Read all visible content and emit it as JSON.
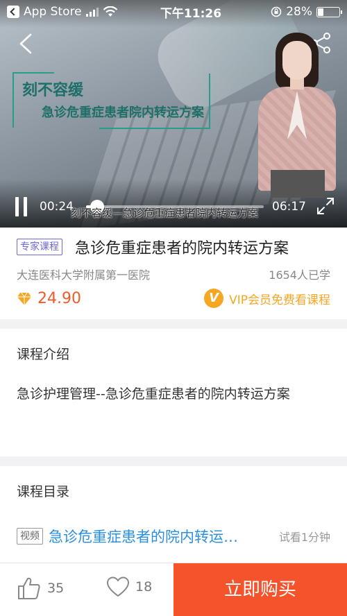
{
  "status_bar": {
    "back_app": "App Store",
    "time": "下午11:26",
    "battery_percent": "28%",
    "battery_level": 0.28
  },
  "video": {
    "title_big": "刻不容缓",
    "title_sub": "急诊危重症患者院内转运方案",
    "subtitle": "刻不容缓—急诊危重症患者院内转运方案",
    "current_time": "00:24",
    "total_time": "06:17",
    "progress": 0.064
  },
  "course": {
    "tag": "专家课程",
    "title": "急诊危重症患者的院内转运方案",
    "institution": "大连医科大学附属第一医院",
    "learners": "1654人已学",
    "price": "24.90",
    "vip_icon_letter": "V",
    "vip_text": "VIP会员免费看课程"
  },
  "intro": {
    "heading": "课程介绍",
    "text": "急诊护理管理--急诊危重症患者的院内转运方案"
  },
  "catalog": {
    "heading": "课程目录",
    "lessons": [
      {
        "tag": "视频",
        "title": "急诊危重症患者的院内转运方案",
        "trial": "试看1分钟"
      }
    ]
  },
  "bottom_bar": {
    "likes": "35",
    "favorites": "18",
    "buy_label": "立即购买"
  },
  "colors": {
    "accent": "#f4532c",
    "price": "#f05a28",
    "vip": "#f5a623",
    "link": "#2b8fe0",
    "expert_tag": "#6f68d8"
  }
}
